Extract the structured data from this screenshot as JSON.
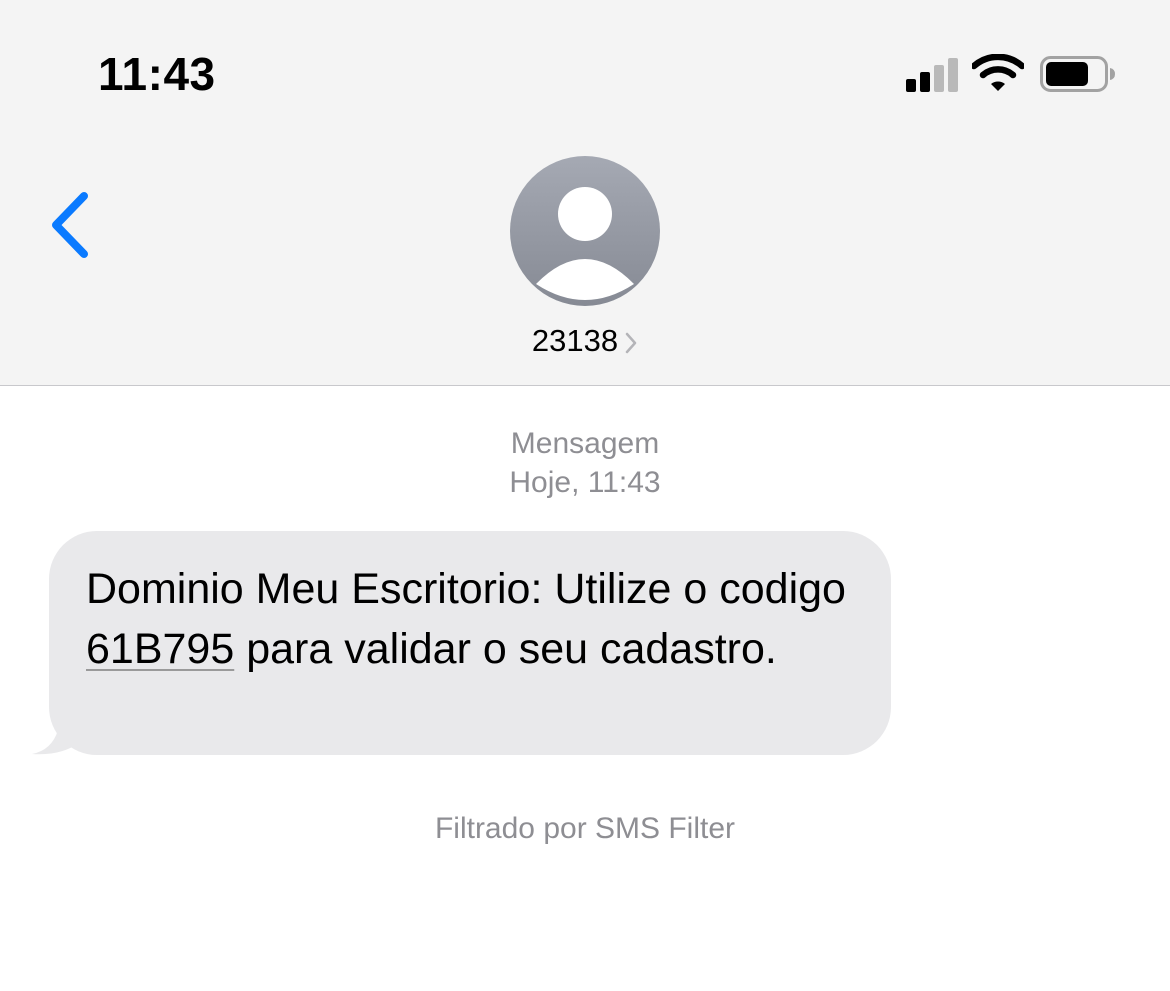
{
  "status_bar": {
    "time": "11:43",
    "signal_bars": 2,
    "signal_bars_total": 4,
    "battery_level": 0.75
  },
  "nav": {
    "back_icon": "chevron-left-icon",
    "contact": {
      "name": "23138",
      "avatar_icon": "person-icon",
      "disclosure_icon": "chevron-right-icon"
    }
  },
  "thread": {
    "meta_line1": "Mensagem",
    "meta_line2": "Hoje, 11:43",
    "message": {
      "before_code": "Dominio Meu Escritorio: Utilize o codigo ",
      "code": "61B795",
      "after_code": " para validar o seu cadastro."
    },
    "filter_note": "Filtrado por SMS Filter"
  },
  "colors": {
    "accent": "#0a7aff",
    "header_bg": "#f4f4f4",
    "bubble_bg": "#e9e9eb",
    "secondary_text": "#8e8e93"
  }
}
